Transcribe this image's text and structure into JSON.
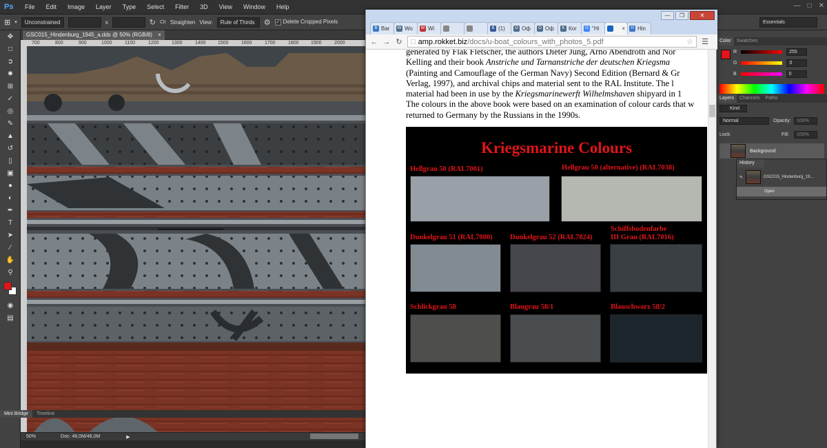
{
  "photoshop": {
    "logo": "Ps",
    "menu": [
      "File",
      "Edit",
      "Image",
      "Layer",
      "Type",
      "Select",
      "Filter",
      "3D",
      "View",
      "Window",
      "Help"
    ],
    "options": {
      "crop_preset": "Unconstrained",
      "times": "x",
      "straighten": "Straighten",
      "view_label": "View:",
      "view_value": "Rule of Thirds",
      "delete_cropped": "Delete Cropped Pixels",
      "workspace": "Essentials"
    },
    "document_tab": "GSC015_Hindenburg_1945_a.dds @ 50% (RGB/8)",
    "ruler_ticks": [
      "700",
      "800",
      "900",
      "1000",
      "1100",
      "1200",
      "1300",
      "1400",
      "1500",
      "1600",
      "1700",
      "1800",
      "1900",
      "2000"
    ],
    "status": {
      "zoom": "50%",
      "doc": "Doc: 48,0M/48,0M"
    },
    "bottom_tabs": [
      "Mini Bridge",
      "Timeline"
    ],
    "color_panel": {
      "tabs": [
        "Color",
        "Swatches"
      ],
      "channels": [
        {
          "label": "R",
          "value": "255"
        },
        {
          "label": "G",
          "value": "0"
        },
        {
          "label": "B",
          "value": "0"
        }
      ]
    },
    "layers_panel": {
      "tabs": [
        "Layers",
        "Channels",
        "Paths"
      ],
      "kind": "Kind",
      "blend": "Normal",
      "opacity_label": "Opacity:",
      "opacity_value": "100%",
      "lock_label": "Lock:",
      "fill_label": "Fill:",
      "fill_value": "100%",
      "layer_name": "Background"
    },
    "history_panel": {
      "title": "History",
      "snapshot": "GSC015_Hindenburg_19...",
      "step": "Open"
    },
    "colors": {
      "foreground": "#e0141a",
      "background": "#ffffff"
    }
  },
  "chrome": {
    "tabs": [
      {
        "label": "Bar",
        "icon": "B",
        "color": "#3b78c3"
      },
      {
        "label": "Wo",
        "icon": "W",
        "color": "#4f6d8a"
      },
      {
        "label": "Wi",
        "icon": "W",
        "color": "#b33"
      },
      {
        "label": "",
        "icon": "doc",
        "color": "#888"
      },
      {
        "label": "",
        "icon": "arrow",
        "color": "#888"
      },
      {
        "label": "(1)",
        "icon": "B",
        "color": "#3b5998"
      },
      {
        "label": "Оф",
        "icon": "O",
        "color": "#4f6d8a"
      },
      {
        "label": "Оф",
        "icon": "O",
        "color": "#4f6d8a"
      },
      {
        "label": "Ког",
        "icon": "K",
        "color": "#4f6d8a"
      },
      {
        "label": "\"Hi",
        "icon": "G",
        "color": "#4285f4"
      },
      {
        "label": "",
        "icon": "active",
        "color": "#1565c0"
      },
      {
        "label": "Hin",
        "icon": "H",
        "color": "#3b78c3"
      }
    ],
    "url_host": "amp.rokket.biz",
    "url_path": "/docs/u-boat_colours_with_photos_5.pdf"
  },
  "pdf": {
    "lines": [
      "generated by Flak Fletscher, the authors Dieter Jung, Arno Abendroth and Nor",
      "Kelling and their book |Anstriche und Tarnanstriche der deutschen Kriegsma",
      "(Painting and Camouflage of the German Navy) Second Edition (Bernard & Gr",
      "Verlag, 1997), and archival chips and material sent to the RAL Institute. The l",
      "material had been in use by the |Kriegsmarinewerft Wilhelmshaven| shipyard in 1",
      "The colours in the above book were based on an examination of colour cards that w",
      "returned to Germany by the Russians in the 1990s."
    ],
    "line1": "generated by Flak Fletscher, the authors Dieter Jung, Arno Abendroth and Nor",
    "line2a": "Kelling and their book ",
    "line2b": "Anstriche und Tarnanstriche der deutschen Kriegsma",
    "line3": "(Painting and Camouflage of the German Navy) Second Edition (Bernard & Gr",
    "line4": "Verlag, 1997), and archival chips and material sent to the RAL Institute. The l",
    "line5a": "material had been in use by the ",
    "line5b": "Kriegsmarinewerft Wilhelmshaven",
    "line5c": " shipyard in 1",
    "line6": "The colours in the above book were based on an examination of colour cards that w",
    "line7": "returned to Germany by the Russians in the 1990s.",
    "figure_title": "Kriegsmarine Colours",
    "swatches": [
      {
        "label": "Hellgrau 50 (RAL7001)",
        "color": "#99a0a8"
      },
      {
        "label": "Hellgrau 50 (alternative) (RAL7038)",
        "color": "#b5b8b0"
      },
      {
        "label": "Dunkelgrau 51 (RAL7000)",
        "color": "#828a92"
      },
      {
        "label": "Dunkelgrau 52 (RAL7024)",
        "color": "#45474c"
      },
      {
        "label": "Schiffsbodenfarbe\nIII Grau (RAL7016)",
        "color": "#3a3f43"
      },
      {
        "label": "Schlickgrau 58",
        "color": "#4e4f4c"
      },
      {
        "label": "Blaugrau 58/1",
        "color": "#4a4d50"
      },
      {
        "label": "Blauschwarz 58/2",
        "color": "#1d252c"
      }
    ]
  }
}
